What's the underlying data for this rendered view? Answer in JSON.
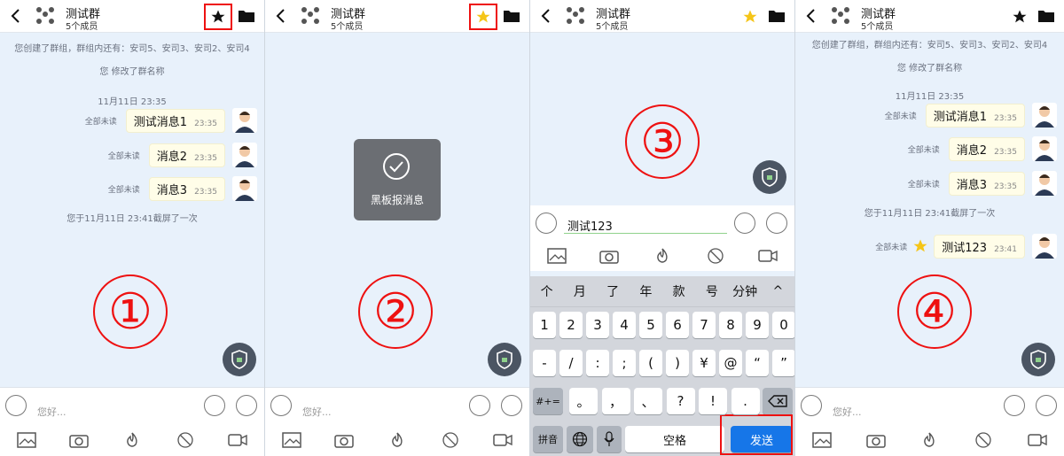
{
  "chat": {
    "title": "测试群",
    "subtitle": "5个成员",
    "sys_created": "您创建了群组，群组内还有：安司5、安司3、安司2、安司4",
    "sys_renamed": "您 修改了群名称",
    "time_label": "11月11日 23:35",
    "screenshot_notice": "您于11月11日 23:41截屏了一次",
    "messages": [
      {
        "unread": "全部未读",
        "text": "测试消息1",
        "time": "23:35"
      },
      {
        "unread": "全部未读",
        "text": "消息2",
        "time": "23:35"
      },
      {
        "unread": "全部未读",
        "text": "消息3",
        "time": "23:35"
      }
    ],
    "new_message": {
      "unread": "全部未读",
      "text": "测试123",
      "time": "23:41"
    },
    "input_placeholder": "您好..."
  },
  "toast": {
    "label": "黑板报消息"
  },
  "step_numbers": [
    "①",
    "②",
    "③",
    "④"
  ],
  "panel3": {
    "typed_text": "测试123",
    "suggestions": [
      "个",
      "月",
      "了",
      "年",
      "款",
      "号",
      "分钟",
      "^"
    ],
    "row_digits": [
      "1",
      "2",
      "3",
      "4",
      "5",
      "6",
      "7",
      "8",
      "9",
      "0"
    ],
    "row_symbols": [
      "-",
      "/",
      ":",
      ";",
      "(",
      ")",
      "¥",
      "@",
      "“",
      "”"
    ],
    "row_punct": [
      "。",
      "，",
      "、",
      "?",
      "!",
      "."
    ],
    "key_switch": "#+=",
    "key_pinyin": "拼音",
    "key_space": "空格",
    "key_send": "发送"
  },
  "colors": {
    "highlight": "#e11111",
    "star_gold": "#f5c518",
    "send_blue": "#1676e8",
    "panel_bg": "#e8f1fb"
  }
}
